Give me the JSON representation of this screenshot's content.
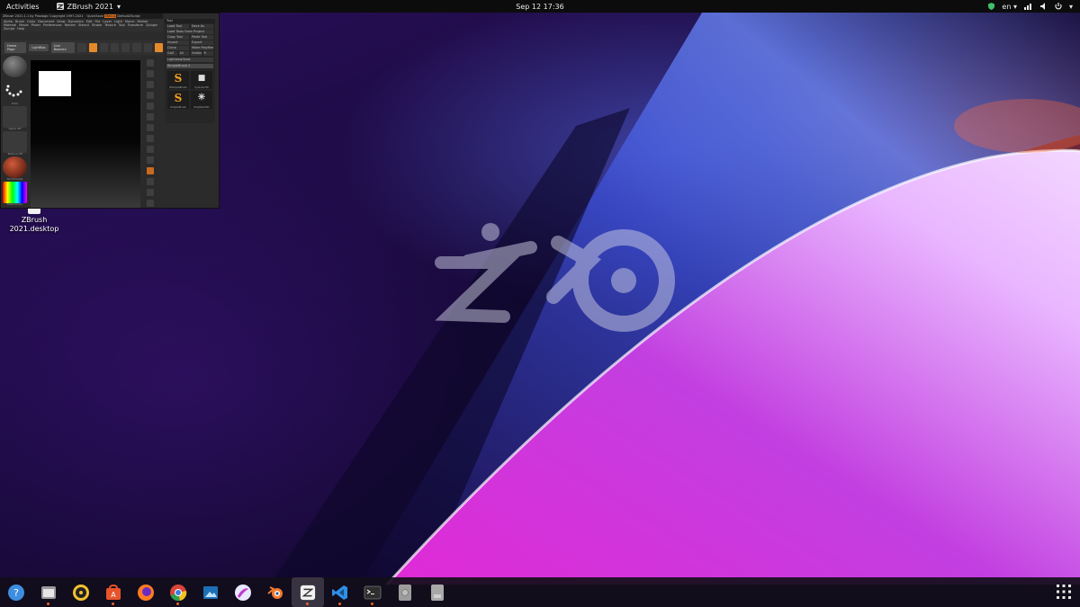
{
  "topbar": {
    "activities": "Activities",
    "app_name": "ZBrush 2021",
    "clock": "Sep 12  17:36",
    "language": "en"
  },
  "desktop": {
    "icon_label": "ZBrush 2021.desktop"
  },
  "zbrush": {
    "title": "ZBrush 2021.1.1 by Pixologic Copyright 1997-2021",
    "quicksave": "QuickSave",
    "default_script": "DefaultZScript",
    "menus": [
      "Alpha",
      "Brush",
      "Color",
      "Document",
      "Draw",
      "Dynamics",
      "Edit",
      "File",
      "Layer",
      "Light",
      "Macro",
      "Marker",
      "Material",
      "Movie",
      "Picker",
      "Preferences",
      "Render",
      "Stencil",
      "Stroke",
      "Texture",
      "Tool",
      "Transform",
      "Zplugin",
      "Zscript",
      "Help"
    ],
    "toolbar": {
      "home_page": "Home Page",
      "lightbox": "LightBox",
      "live_boolean": "Live Boolean"
    },
    "left_slots": [
      "",
      "Dots",
      "Alpha Off",
      "Texture Off",
      "SkinShade4",
      "SwitchColor"
    ],
    "tool_panel": {
      "header": "Tool",
      "rows": [
        [
          "Load Tool",
          "Save As"
        ],
        [
          "Load Tools From Project",
          ""
        ],
        [
          "Copy Tool",
          "Paste Tool"
        ],
        [
          "Import",
          "Export"
        ],
        [
          "Clone",
          "Make PolyMesh3D"
        ],
        [
          "GoZ",
          "All",
          "Visible",
          "R"
        ]
      ],
      "lightbox_tools": "Lightbox▸Tools",
      "current_tool": "SimpleBrush  2",
      "brushes": [
        {
          "glyph": "S",
          "name": "ZSimpleBrush"
        },
        {
          "glyph": "■",
          "name": "Cylinder3D"
        },
        {
          "glyph": "S",
          "name": "SimpleBrush"
        },
        {
          "glyph": "✳",
          "name": "PolyMesh3D"
        }
      ]
    }
  },
  "dock": {
    "items": [
      {
        "name": "help-icon",
        "active": false,
        "running": false
      },
      {
        "name": "files-icon",
        "active": false,
        "running": true
      },
      {
        "name": "rhythmbox-icon",
        "active": false,
        "running": false
      },
      {
        "name": "software-store-icon",
        "active": false,
        "running": true
      },
      {
        "name": "firefox-icon",
        "active": false,
        "running": false
      },
      {
        "name": "chrome-icon",
        "active": false,
        "running": true
      },
      {
        "name": "image-viewer-icon",
        "active": false,
        "running": false
      },
      {
        "name": "krita-icon",
        "active": false,
        "running": false
      },
      {
        "name": "blender-icon",
        "active": false,
        "running": false
      },
      {
        "name": "zbrush-icon",
        "active": true,
        "running": true
      },
      {
        "name": "vscode-icon",
        "active": false,
        "running": true
      },
      {
        "name": "terminal-icon",
        "active": false,
        "running": true
      },
      {
        "name": "drive-icon",
        "active": false,
        "running": false
      },
      {
        "name": "removable-drive-icon",
        "active": false,
        "running": false
      }
    ]
  }
}
